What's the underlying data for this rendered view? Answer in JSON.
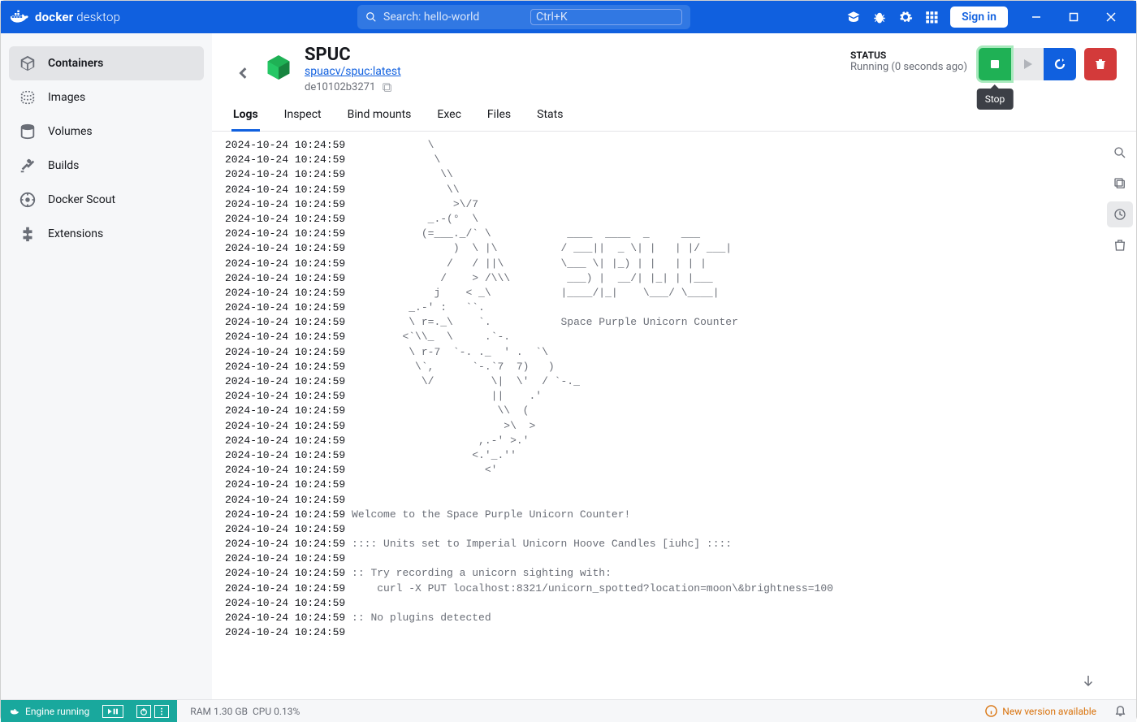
{
  "titlebar": {
    "product": "docker",
    "product2": "desktop",
    "search_placeholder": "Search: hello-world",
    "kbd": "Ctrl+K",
    "signin": "Sign in"
  },
  "sidebar": {
    "items": [
      {
        "label": "Containers"
      },
      {
        "label": "Images"
      },
      {
        "label": "Volumes"
      },
      {
        "label": "Builds"
      },
      {
        "label": "Docker Scout"
      },
      {
        "label": "Extensions"
      }
    ]
  },
  "container": {
    "name": "SPUC",
    "image": "spuacv/spuc:latest",
    "id": "de10102b3271",
    "status_label": "STATUS",
    "status_text": "Running (0 seconds ago)",
    "tooltip_stop": "Stop"
  },
  "tabs": [
    "Logs",
    "Inspect",
    "Bind mounts",
    "Exec",
    "Files",
    "Stats"
  ],
  "logs": {
    "ts": "2024-10-24 10:24:59",
    "lines": [
      "            \\",
      "             \\",
      "              \\\\",
      "               \\\\",
      "                >\\/7",
      "            _.-(°  \\",
      "           (=___._/` \\            ____  ____  _     ___",
      "                )  \\ |\\          / ___||  _ \\| |   | |/ ___|",
      "               /   / ||\\         \\___ \\| |_) | |   | | |",
      "              /    > /\\\\\\         ___) |  __/| |_| | |___",
      "             j    < _\\           |____/|_|    \\___/ \\____|",
      "         _.-' :   ``.",
      "         \\ r=._\\    `.           Space Purple Unicorn Counter",
      "        <`\\\\_  \\     .`-.",
      "         \\ r-7  `-. ._  ' .  `\\",
      "          \\`,      `-.`7  7)   )",
      "           \\/         \\|  \\'  / `-._",
      "                      ||    .'",
      "                       \\\\  (",
      "                        >\\  >",
      "                    ,.-' >.'",
      "                   <.'_.''",
      "                     <'",
      "",
      "",
      "Welcome to the Space Purple Unicorn Counter!",
      "",
      ":::: Units set to Imperial Unicorn Hoove Candles [iuhc] ::::",
      "",
      ":: Try recording a unicorn sighting with:",
      "    curl -X PUT localhost:8321/unicorn_spotted?location=moon\\&brightness=100",
      "",
      ":: No plugins detected",
      ""
    ]
  },
  "statusbar": {
    "engine": "Engine running",
    "ram": "RAM 1.30 GB",
    "cpu": "CPU 0.13%",
    "update": "New version available"
  }
}
